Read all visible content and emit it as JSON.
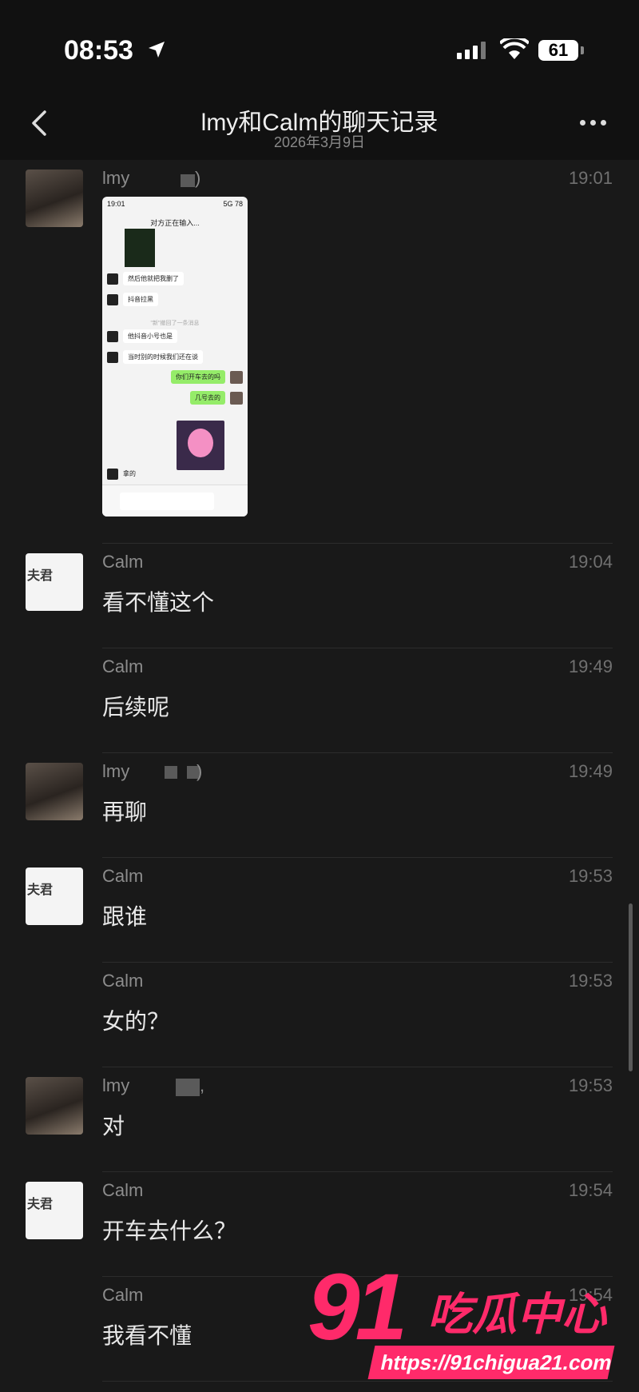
{
  "status": {
    "time": "08:53",
    "battery": "61"
  },
  "nav": {
    "title": "lmy和Calm的聊天记录",
    "subtitle": "2026年3月9日"
  },
  "messages": [
    {
      "sender": "lmy",
      "time": "19:01",
      "type": "image",
      "sender_suffix": ")"
    },
    {
      "sender": "Calm",
      "time": "19:04",
      "text": "看不懂这个",
      "avatar": true
    },
    {
      "sender": "Calm",
      "time": "19:49",
      "text": "后续呢",
      "avatar": false
    },
    {
      "sender": "lmy",
      "time": "19:49",
      "text": "再聊",
      "avatar": true,
      "sender_suffix": ")"
    },
    {
      "sender": "Calm",
      "time": "19:53",
      "text": "跟谁",
      "avatar": true
    },
    {
      "sender": "Calm",
      "time": "19:53",
      "text": "女的？",
      "avatar": false
    },
    {
      "sender": "lmy",
      "time": "19:53",
      "text": "对",
      "avatar": true,
      "sender_suffix": ","
    },
    {
      "sender": "Calm",
      "time": "19:54",
      "text": "开车去什么？",
      "avatar": true
    },
    {
      "sender": "Calm",
      "time": "19:54",
      "text": "我看不懂",
      "avatar": false
    }
  ],
  "calm_avatar_label": "夫君",
  "screenshot": {
    "time": "19:01",
    "signal": "5G",
    "battery": "78",
    "title": "对方正在输入...",
    "lines": [
      "然后他就把我删了",
      "抖音拉黑",
      "他抖音小号也是",
      "当时别的时候我们还在谈",
      "你们开车去的吗",
      "几号去的",
      "拿的"
    ],
    "note": "\"新\"撤回了一条消息"
  },
  "watermark": {
    "brand_num": "91",
    "brand_cn": "吃瓜中心",
    "url": "https://91chigua21.com"
  },
  "icons": [
    "location-arrow-icon",
    "signal-icon",
    "wifi-icon",
    "battery-icon",
    "back-chevron-icon",
    "more-icon"
  ]
}
